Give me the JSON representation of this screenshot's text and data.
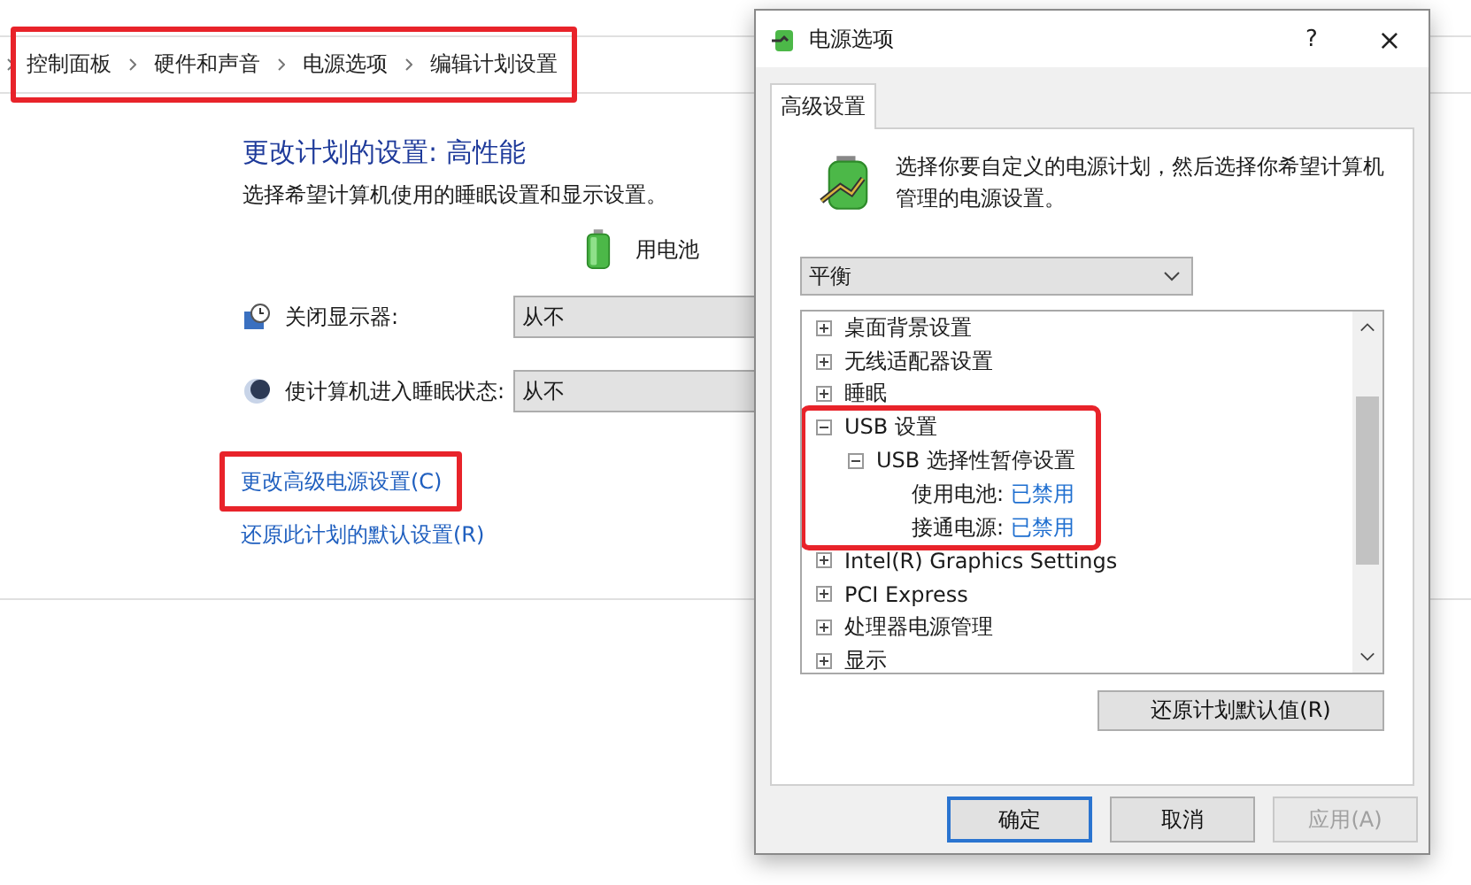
{
  "breadcrumb": {
    "highlighted": true,
    "items": [
      "控制面板",
      "硬件和声音",
      "电源选项",
      "编辑计划设置"
    ]
  },
  "plan": {
    "title": "更改计划的设置: 高性能",
    "subtitle": "选择希望计算机使用的睡眠设置和显示设置。",
    "column": "用电池",
    "settings": [
      {
        "kind": "display",
        "label": "关闭显示器:",
        "value": "从不"
      },
      {
        "kind": "sleep",
        "label": "使计算机进入睡眠状态:",
        "value": "从不"
      }
    ],
    "links": [
      {
        "label": "更改高级电源设置(C)",
        "highlighted": true
      },
      {
        "label": "还原此计划的默认设置(R)",
        "highlighted": false
      }
    ]
  },
  "dialog": {
    "title": "电源选项",
    "help": "?",
    "close": "×",
    "tabs": [
      {
        "label": "高级设置",
        "selected": true
      }
    ],
    "intro": "选择你要自定义的电源计划，然后选择你希望计算机管理的电源设置。",
    "plan_select": {
      "value": "平衡"
    },
    "tree": [
      {
        "kind": "group",
        "label": "桌面背景设置",
        "expanded": false,
        "highlighted": false
      },
      {
        "kind": "group",
        "label": "无线适配器设置",
        "expanded": false,
        "highlighted": false
      },
      {
        "kind": "group",
        "label": "睡眠",
        "expanded": false,
        "highlighted": false
      },
      {
        "kind": "group",
        "label": "USB 设置",
        "expanded": true,
        "highlighted": true,
        "children": [
          {
            "kind": "group",
            "label": "USB 选择性暂停设置",
            "expanded": true,
            "children": [
              {
                "kind": "setting",
                "label": "使用电池:",
                "value": "已禁用"
              },
              {
                "kind": "setting",
                "label": "接通电源:",
                "value": "已禁用"
              }
            ]
          }
        ]
      },
      {
        "kind": "group",
        "label": "Intel(R) Graphics Settings",
        "expanded": false,
        "highlighted": false
      },
      {
        "kind": "group",
        "label": "PCI Express",
        "expanded": false,
        "highlighted": false
      },
      {
        "kind": "group",
        "label": "处理器电源管理",
        "expanded": false,
        "highlighted": false
      },
      {
        "kind": "group",
        "label": "显示",
        "expanded": false,
        "highlighted": false
      }
    ],
    "restore_button": "还原计划默认值(R)",
    "buttons": [
      {
        "label": "确定",
        "default": true,
        "disabled": false
      },
      {
        "label": "取消",
        "default": false,
        "disabled": false
      },
      {
        "label": "应用(A)",
        "default": false,
        "disabled": true
      }
    ]
  }
}
